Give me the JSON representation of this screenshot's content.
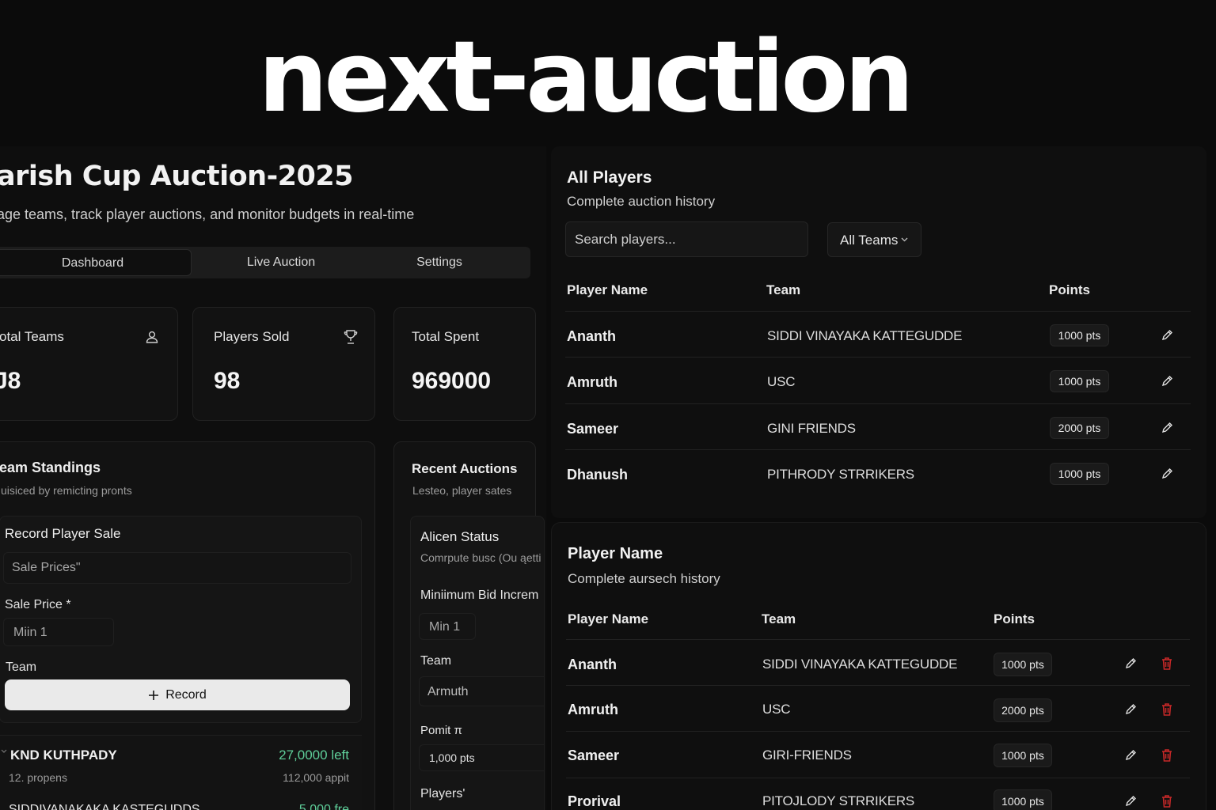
{
  "app": {
    "title": "next-auction"
  },
  "header": {
    "title": "arish Cup Auction-2025",
    "subtitle": "age teams, track player auctions, and monitor budgets in real-time"
  },
  "tabs": [
    {
      "label": "Dashboard",
      "active": true
    },
    {
      "label": "Live Auction",
      "active": false
    },
    {
      "label": "Settings",
      "active": false
    }
  ],
  "stats": [
    {
      "label": "otal Teams",
      "value": "J8",
      "icon": "users-icon"
    },
    {
      "label": "Players Sold",
      "value": "98",
      "icon": "trophy-icon"
    },
    {
      "label": "Total Spent",
      "value": "969000"
    }
  ],
  "standings": {
    "title": "eam Standings",
    "subtitle": "uisiced by remicting pronts",
    "form": {
      "title": "Record Player Sale",
      "sale_price_placeholder": "Sale Prices\"",
      "sale_price_label": "Sale Price *",
      "min_placeholder": "Miin 1",
      "team_label": "Team",
      "record_button": "Record",
      "record_icon": "plus-icon"
    },
    "teams": [
      {
        "name": "KND KUTHPADY",
        "left": "27,0000 left",
        "sub": "12. propens",
        "spent": "112,000 appit"
      },
      {
        "name": "SIDDIVANAKAKA KASTEGUDDS",
        "left": "5,000 fre",
        "sub": "",
        "spent": ""
      }
    ]
  },
  "recent": {
    "title": "Recent Auctions",
    "subtitle": "Lesteo, player sates",
    "status_title": "Alicen Status",
    "status_sub": "Comrpute busc (Ou ąetti",
    "min_bid_label": "Miniimum Bid Increm",
    "min_value": "Min 1",
    "team_label": "Team",
    "team_value": "Armuth",
    "points_label": "Pomit π",
    "points_value": "1,000 pts",
    "players_label": "Players'"
  },
  "all_players": {
    "title": "All Players",
    "subtitle": "Complete auction history",
    "search_placeholder": "Search players...",
    "filter_label": "All Teams",
    "filter_icon": "chevron-down-icon",
    "columns": [
      "Player Name",
      "Team",
      "Points"
    ],
    "rows": [
      {
        "name": "Ananth",
        "team": "SIDDI VINAYAKA KATTEGUDDE",
        "points": "1000 pts"
      },
      {
        "name": "Amruth",
        "team": "USC",
        "points": "1000 pts"
      },
      {
        "name": "Sameer",
        "team": "GINI FRIENDS",
        "points": "2000 pts"
      },
      {
        "name": "Dhanush",
        "team": "PITHRODY STRRIKERS",
        "points": "1000 pts"
      }
    ]
  },
  "player_history": {
    "title": "Player Name",
    "subtitle": "Complete aursech history",
    "columns": [
      "Player Name",
      "Team",
      "Points"
    ],
    "rows": [
      {
        "name": "Ananth",
        "team": "SIDDI VINAYAKA KATTEGUDDE",
        "points": "1000 pts"
      },
      {
        "name": "Amruth",
        "team": "USC",
        "points": "2000 pts"
      },
      {
        "name": "Sameer",
        "team": "GIRI-FRIENDS",
        "points": "1000 pts"
      },
      {
        "name": "Prorival",
        "team": "PITOJLODY STRRIKERS",
        "points": "1000 pts"
      }
    ]
  },
  "colors": {
    "accent_green": "#5fcf9a",
    "delete_red": "#c62828",
    "background": "#0b0b0b"
  }
}
